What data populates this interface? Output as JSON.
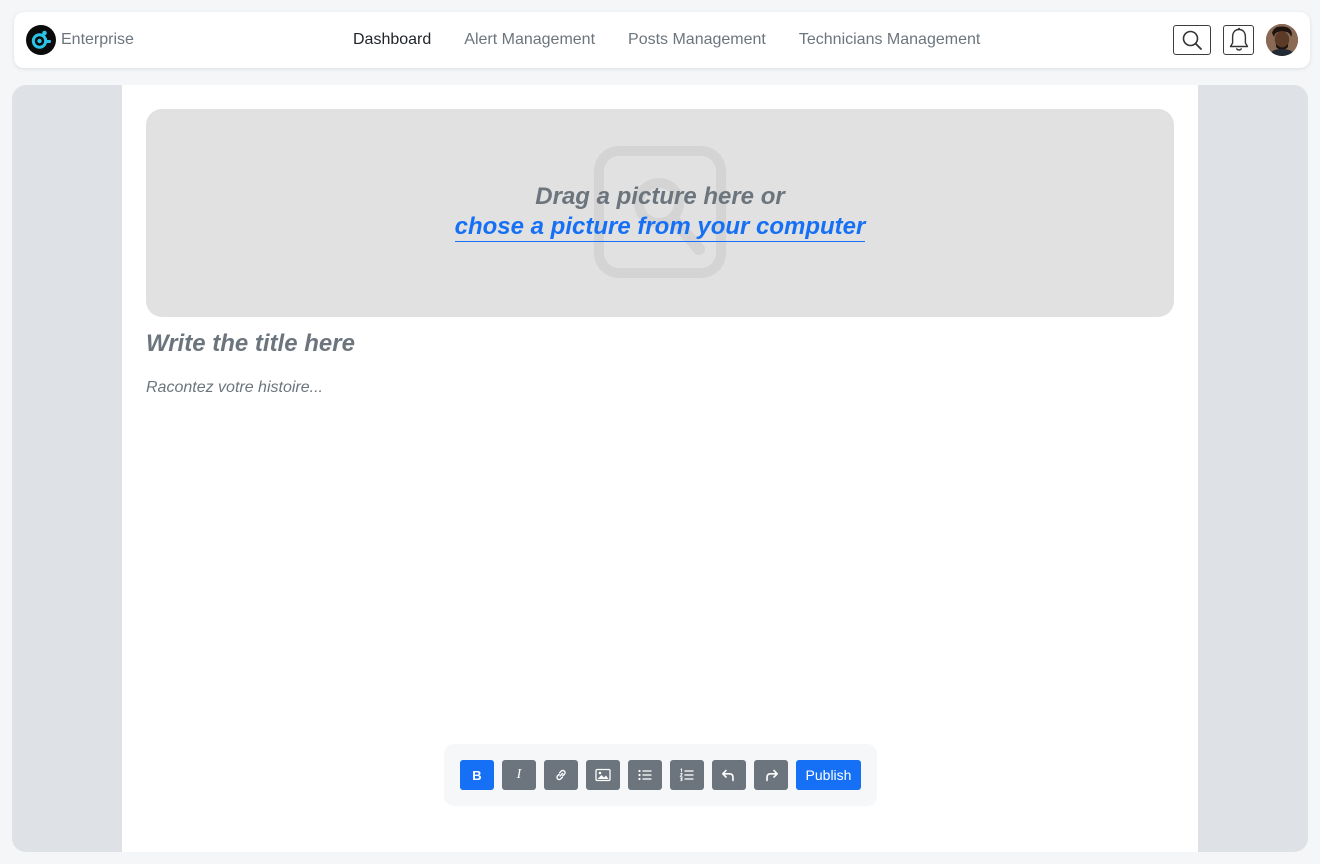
{
  "header": {
    "brand_name": "Enterprise",
    "nav": [
      {
        "label": "Dashboard",
        "active": true
      },
      {
        "label": "Alert Management",
        "active": false
      },
      {
        "label": "Posts Management",
        "active": false
      },
      {
        "label": "Technicians Management",
        "active": false
      }
    ],
    "icons": [
      "search-icon",
      "bell-icon",
      "user-avatar"
    ]
  },
  "editor": {
    "dropzone": {
      "line1": "Drag a picture here or",
      "link": "chose a picture from your computer"
    },
    "title_placeholder": "Write the title here",
    "story_placeholder": "Racontez votre histoire..."
  },
  "toolbar": {
    "bold_label": "B",
    "italic_label": "I",
    "tools": [
      "bold-icon",
      "italic-icon",
      "link-icon",
      "image-icon",
      "bullet-list-icon",
      "numbered-list-icon",
      "undo-icon",
      "redo-icon"
    ],
    "publish_label": "Publish"
  },
  "colors": {
    "accent": "#1670f5",
    "muted": "#6c757d",
    "stage_bg": "#dee1e6",
    "dropzone_bg": "#e1e1e1"
  }
}
